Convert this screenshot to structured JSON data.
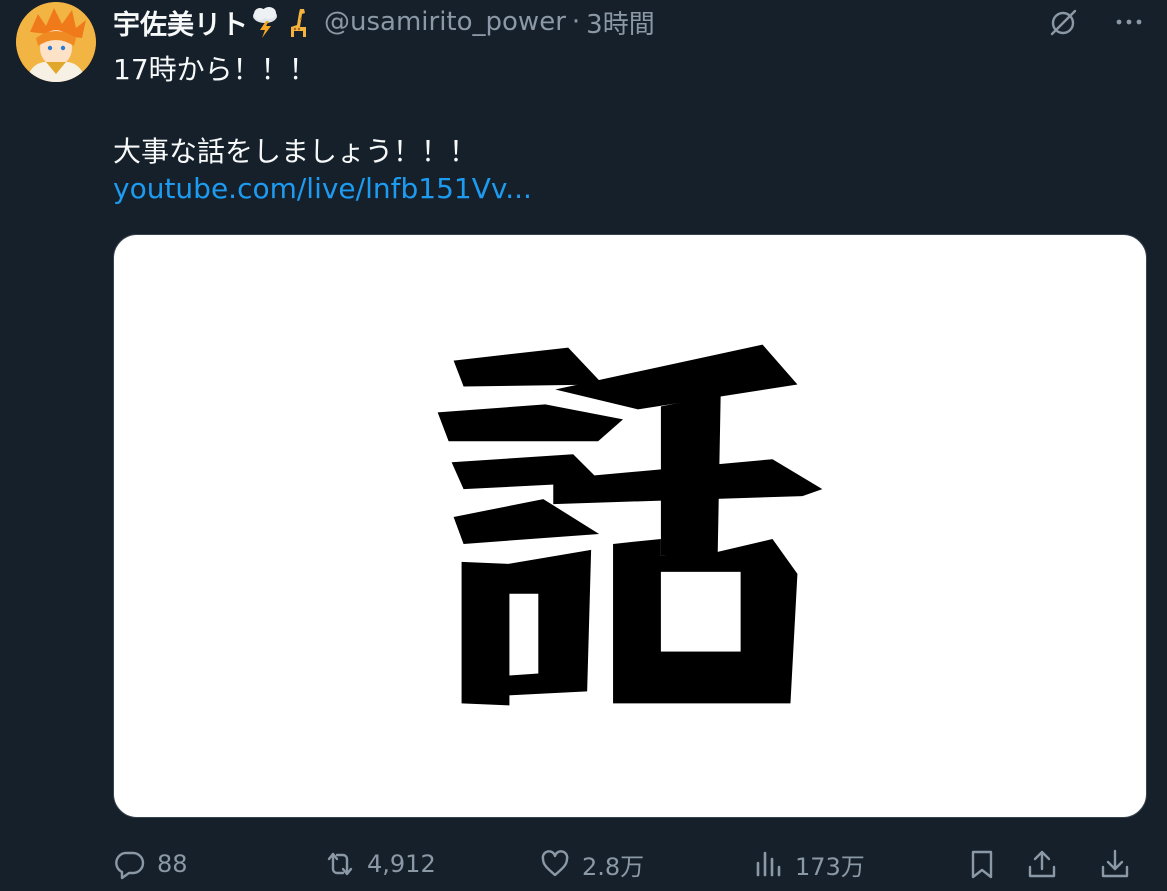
{
  "tweet": {
    "display_name": "宇佐美リト",
    "name_emojis": [
      "cloud-lightning-emoji",
      "giraffe-emoji"
    ],
    "handle": "@usamirito_power",
    "separator": "·",
    "time": "3時間",
    "text_line1": "17時から！！！",
    "text_line2": "大事な話をしましょう！！！",
    "link": "youtube.com/live/lnfb151Vv...",
    "media_character": "話"
  },
  "top_icons": [
    "grok-icon",
    "more-icon"
  ],
  "actions": {
    "replies": "88",
    "retweets": "4,912",
    "likes": "2.8万",
    "views": "173万"
  },
  "colors": {
    "background": "#15202b",
    "text": "#f7f9f9",
    "secondary": "#8b98a5",
    "link": "#1d9bf0",
    "media_bg": "#ffffff"
  }
}
